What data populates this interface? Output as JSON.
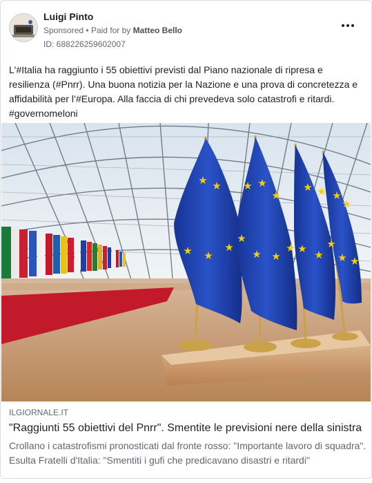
{
  "ad": {
    "page_name": "Luigi Pinto",
    "sponsored_label": "Sponsored",
    "separator": "•",
    "paid_for_prefix": "Paid for by",
    "paid_for_name": "Matteo Bello",
    "library_id": "ID: 688226259602007",
    "more_icon": "ellipsis-icon"
  },
  "post": {
    "text": "L'#Italia ha raggiunto i 55 obiettivi previsti dal Piano nazionale di ripresa e resilienza (#Pnrr). Una buona notizia per la Nazione e una prova di concretezza e affidabilità per l’#Europa. Alla faccia di chi prevedeva solo catastrofi e ritardi. #governomeloni"
  },
  "link": {
    "domain": "ILGIORNALE.IT",
    "title": "\"Raggiunti 55 obiettivi del Pnrr\". Smentite le previsioni nere della sinistra",
    "description": "Crollano i catastrofismi pronosticati dal fronte rosso: \"Importante lavoro di squadra\". Esulta Fratelli d'Italia: \"Smentiti i gufi che predicavano disastri e ritardi\""
  },
  "colors": {
    "eu_blue": "#1f3fa8",
    "eu_star": "#f5d000",
    "carpet_red": "#c21a2a"
  }
}
